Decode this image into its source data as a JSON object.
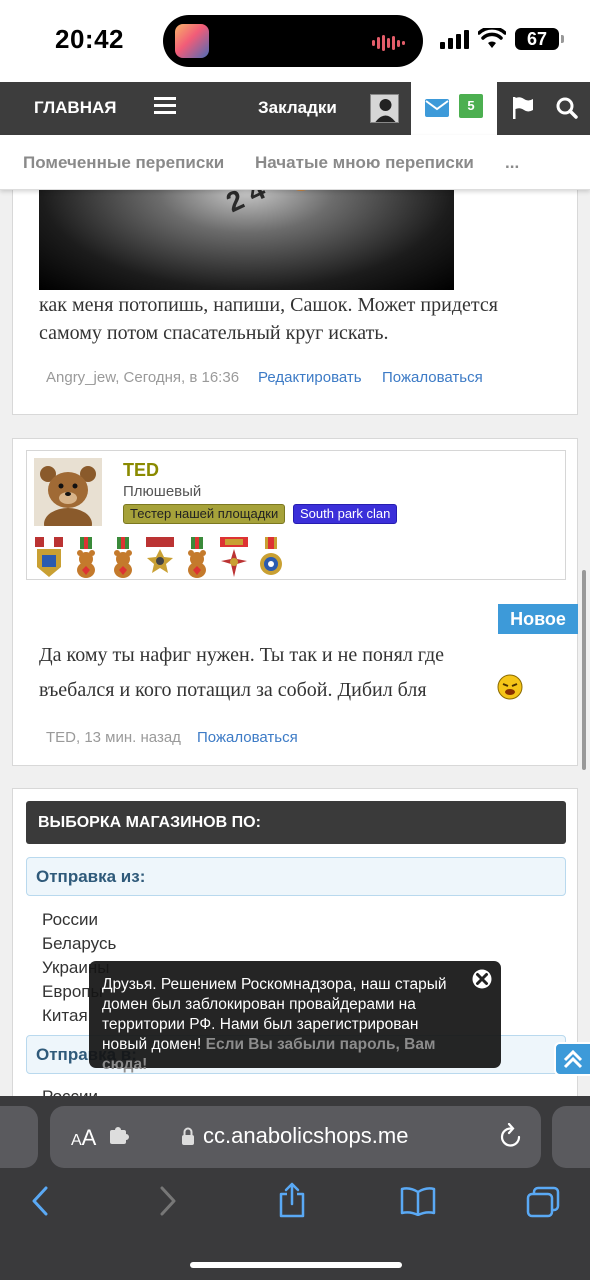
{
  "status_bar": {
    "time": "20:42",
    "battery": "67"
  },
  "nav": {
    "home": "ГЛАВНАЯ",
    "bookmarks": "Закладки",
    "messages_count": "5"
  },
  "sub_nav": {
    "marked": "Помеченные переписки",
    "started": "Начатые мною переписки",
    "more": "..."
  },
  "post1": {
    "text_line1": "как меня потопишь, напиши, Сашок. Может придется",
    "text_line2": "самому потом спасательный круг искать.",
    "meta": "Angry_jew, Сегодня, в 16:36",
    "edit": "Редактировать",
    "report": "Пожаловаться"
  },
  "post2": {
    "author": "TED",
    "user_title": "Плюшевый",
    "tag1": "Тестер нашей площадки",
    "tag2": "South park clan",
    "new_badge": "Новое",
    "text_line1": "Да кому ты нафиг нужен. Ты так и не понял где",
    "text_line2": "въебался и кого потащил за собой. Дибил бля",
    "meta": "TED, 13 мин. назад",
    "report": "Пожаловаться"
  },
  "shops": {
    "header": "ВЫБОРКА МАГАЗИНОВ ПО:",
    "from_label": "Отправка из:",
    "countries": [
      "России",
      "Беларусь",
      "Украины",
      "Европы",
      "Китая"
    ],
    "to_label": "Отправка в:",
    "to_first": "России"
  },
  "toast": {
    "text": "Друзья. Решением Роскомнадзора, наш старый домен был заблокирован провайдерами на территории РФ. Нами был зарегистрирован новый домен!",
    "link": "Если Вы забыли пароль, Вам сюда!"
  },
  "safari": {
    "aa_big": "A",
    "aa_small": "A",
    "url": "cc.anabolicshops.me"
  },
  "colors": {
    "nav_bg": "#3d3d3d",
    "badge_green": "#4caf50",
    "accent_blue": "#3d9ad9",
    "author_olive": "#8a8a00",
    "tag_tester": "#a6a23a",
    "tag_southpark": "#3b2fd9"
  },
  "icons": [
    "menu-icon",
    "mail-icon",
    "flag-icon",
    "search-icon",
    "close-icon",
    "lock-icon",
    "reload-icon",
    "back-icon",
    "forward-icon",
    "share-icon",
    "bookmarks-icon",
    "tabs-icon",
    "scroll-top-icon",
    "emoji-icon"
  ]
}
